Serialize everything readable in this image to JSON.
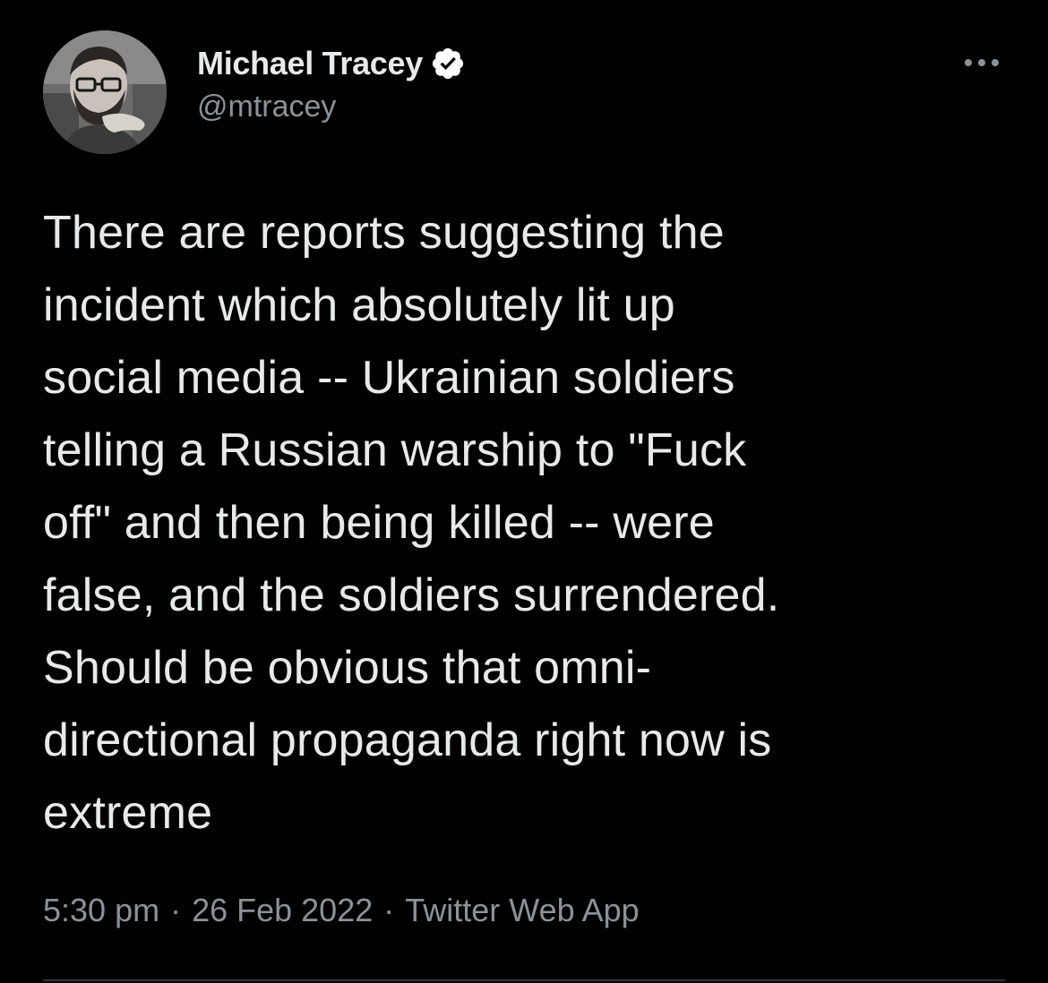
{
  "author": {
    "display_name": "Michael Tracey",
    "handle": "@mtracey",
    "verified": true,
    "avatar_icon": "profile-photo",
    "verified_icon": "verified-badge-icon",
    "verified_color": "#ffffff"
  },
  "menu": {
    "icon": "more-horizontal-icon"
  },
  "tweet": {
    "text": "There are reports suggesting the\nincident which absolutely lit up\nsocial media -- Ukrainian soldiers\ntelling a Russian warship to \"Fuck\noff\" and then being killed -- were\nfalse, and the soldiers surrendered.\nShould be obvious that omni-\ndirectional propaganda right now is\nextreme"
  },
  "meta": {
    "time": "5:30 pm",
    "separator": "·",
    "date": "26 Feb 2022",
    "source": "Twitter Web App"
  },
  "colors": {
    "background": "#000000",
    "primary_text": "#e7e9ea",
    "secondary_text": "#8b9298",
    "divider": "#2f3336"
  }
}
